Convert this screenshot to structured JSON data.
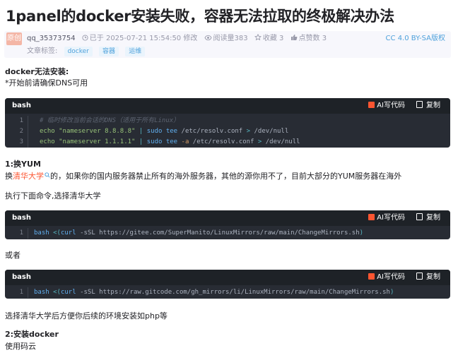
{
  "article": {
    "title": "1panel的docker安装失败，容器无法拉取的终极解决办法",
    "original_badge": "原创",
    "author": "qq_35373754",
    "published": "已于 2025-07-21 15:54:50 修改",
    "views": "阅读量383",
    "favorites": "收藏 3",
    "likes": "点赞数 3",
    "license": "CC 4.0 BY-SA版权",
    "tags_label": "文章标签:",
    "tags": [
      "docker",
      "容器",
      "运维"
    ]
  },
  "content": {
    "h_docker_fail": "docker无法安装:",
    "note_dns": "*开始前请确保DNS可用",
    "h_yum": "1:换YUM",
    "yum_prefix": "换",
    "yum_link": "清华大学",
    "yum_suffix": "的，如果你的国内服务器禁止所有的海外服务器，其他的源你用不了，目前大部分的YUM服务器在海外",
    "exec_cmd": "执行下面命令,选择清华大学",
    "or": "或者",
    "choose_tsinghua": "选择清华大学后方便你后续的环境安装如php等",
    "h_install_docker": "2:安装docker",
    "use_aliyun": "使用码云"
  },
  "code_common": {
    "lang": "bash",
    "ai_label": "AI写代码",
    "copy_label": "复制"
  },
  "code1": {
    "line_numbers": [
      "1",
      "2",
      "3"
    ],
    "comment": "# 临时修改当前会话的DNS（适用于所有Linux）",
    "l2_echo": "echo",
    "l2_str": "\"nameserver 8.8.8.8\"",
    "l2_pipe": "|",
    "l2_sudo": "sudo tee",
    "l2_path": "/etc/resolv.conf",
    "l2_gt": ">",
    "l2_null": "/dev/null",
    "l3_echo": "echo",
    "l3_str": "\"nameserver 1.1.1.1\"",
    "l3_pipe": "|",
    "l3_sudo": "sudo tee",
    "l3_flag": "-a",
    "l3_path": "/etc/resolv.conf",
    "l3_gt": ">",
    "l3_null": "/dev/null"
  },
  "code2": {
    "line_number": "1",
    "cmd": "bash",
    "op": "<(",
    "curl": "curl",
    "flag": "-sSL",
    "url": "https://gitee.com/SuperManito/LinuxMirrors/raw/main/ChangeMirrors.sh",
    "close": ")"
  },
  "code3": {
    "line_number": "1",
    "cmd": "bash",
    "op": "<(",
    "curl": "curl",
    "flag": "-sSL",
    "url": "https://raw.gitcode.com/gh_mirrors/li/LinuxMirrors/raw/main/ChangeMirrors.sh",
    "close": ")"
  }
}
